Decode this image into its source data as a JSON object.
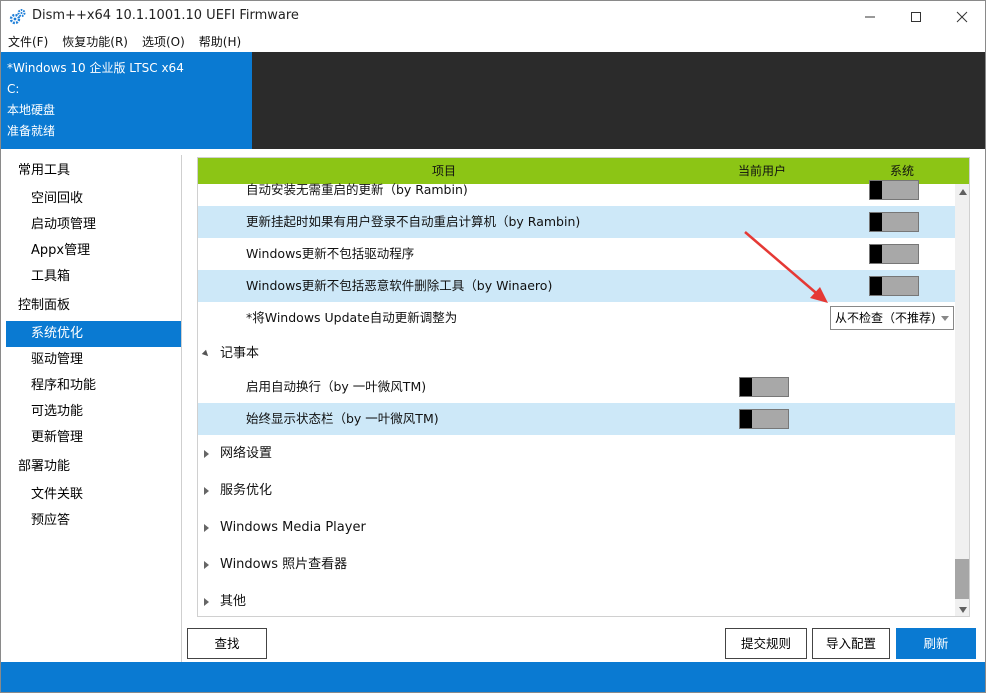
{
  "window": {
    "title": "Dism++x64 10.1.1001.10 UEFI Firmware",
    "controls": {
      "minimize": "—",
      "maximize": "☐",
      "close": "✕"
    }
  },
  "menu": [
    "文件(F)",
    "恢复功能(R)",
    "选项(O)",
    "帮助(H)"
  ],
  "image_info": {
    "name": "*Windows 10 企业版 LTSC x64",
    "drive": "C:",
    "disk": "本地硬盘",
    "status": "准备就绪"
  },
  "sidebar": {
    "groups": [
      {
        "label": "常用工具",
        "items": [
          "空间回收",
          "启动项管理",
          "Appx管理",
          "工具箱"
        ]
      },
      {
        "label": "控制面板",
        "items": [
          "系统优化",
          "驱动管理",
          "程序和功能",
          "可选功能",
          "更新管理"
        ]
      },
      {
        "label": "部署功能",
        "items": [
          "文件关联",
          "预应答"
        ]
      }
    ],
    "active": "系统优化"
  },
  "grid": {
    "headers": {
      "item": "项目",
      "current_user": "当前用户",
      "system": "系统"
    },
    "update_rows": [
      {
        "label": "自动安装无需重启的更新（by Rambin)",
        "toggle_column": "system",
        "on": false
      },
      {
        "label": "更新挂起时如果有用户登录不自动重启计算机（by Rambin)",
        "toggle_column": "system",
        "on": false
      },
      {
        "label": "Windows更新不包括驱动程序",
        "toggle_column": "system",
        "on": false
      },
      {
        "label": "Windows更新不包括恶意软件删除工具（by Winaero)",
        "toggle_column": "system",
        "on": false
      }
    ],
    "update_mode_row": {
      "label": "*将Windows Update自动更新调整为",
      "value": "从不检查（不推荐)"
    },
    "notepad_group": {
      "label": "记事本",
      "rows": [
        {
          "label": "启用自动换行（by 一叶微风TM)",
          "toggle_column": "current_user",
          "on": false
        },
        {
          "label": "始终显示状态栏（by 一叶微风TM)",
          "toggle_column": "current_user",
          "on": false
        }
      ]
    },
    "collapsed_groups": [
      "网络设置",
      "服务优化",
      "Windows Media Player",
      "Windows 照片查看器",
      "其他"
    ]
  },
  "buttons": {
    "find": "查找",
    "submit_rules": "提交规则",
    "import_config": "导入配置",
    "refresh": "刷新"
  },
  "colors": {
    "accent": "#0a7ad2",
    "header_green": "#8cc515",
    "row_highlight": "#cde8f8",
    "annotation_arrow": "#e53935"
  }
}
